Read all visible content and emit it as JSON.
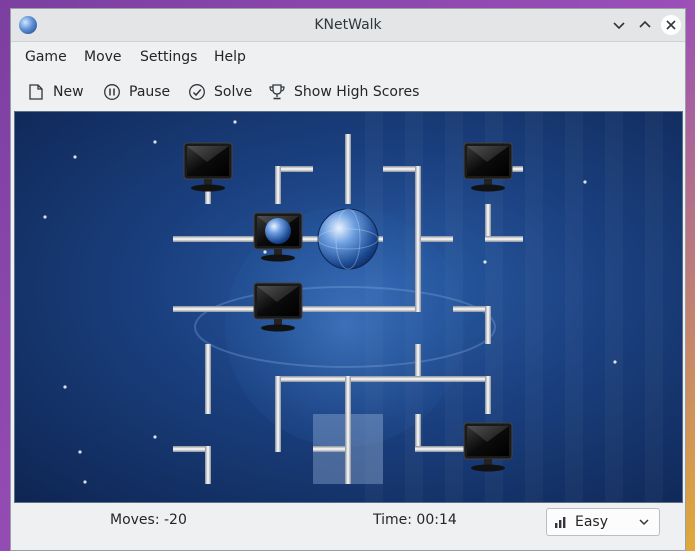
{
  "window": {
    "title": "KNetWalk"
  },
  "menu": [
    "Game",
    "Move",
    "Settings",
    "Help"
  ],
  "toolbar": {
    "new_label": "New",
    "pause_label": "Pause",
    "solve_label": "Solve",
    "highscores_label": "Show High Scores"
  },
  "status": {
    "moves": "Moves: -20",
    "time": "Time: 00:14",
    "difficulty": "Easy"
  },
  "icons": {
    "app": "globe-icon",
    "new": "new-document-icon",
    "pause": "pause-icon",
    "solve": "checkmark-icon",
    "highscores": "trophy-icon",
    "difficulty": "signal-bars-icon"
  },
  "board": {
    "columns": 5,
    "rows": 5,
    "selected_cell": [
      2,
      4
    ],
    "tiles": [
      {
        "col": 0,
        "row": 0,
        "kind": "computer",
        "links": [
          "down"
        ]
      },
      {
        "col": 1,
        "row": 0,
        "kind": "pipe",
        "links": [
          "right",
          "down"
        ]
      },
      {
        "col": 2,
        "row": 0,
        "kind": "pipe",
        "links": [
          "up",
          "down"
        ]
      },
      {
        "col": 3,
        "row": 0,
        "kind": "pipe",
        "links": [
          "left",
          "down"
        ]
      },
      {
        "col": 4,
        "row": 0,
        "kind": "computer",
        "links": [
          "right"
        ]
      },
      {
        "col": 0,
        "row": 1,
        "kind": "pipe",
        "links": [
          "left",
          "right"
        ]
      },
      {
        "col": 1,
        "row": 1,
        "kind": "computer",
        "links": [
          "left",
          "right"
        ]
      },
      {
        "col": 2,
        "row": 1,
        "kind": "server",
        "links": [
          "left",
          "right"
        ]
      },
      {
        "col": 3,
        "row": 1,
        "kind": "pipe",
        "links": [
          "up",
          "right",
          "down"
        ]
      },
      {
        "col": 4,
        "row": 1,
        "kind": "pipe",
        "links": [
          "up",
          "right"
        ]
      },
      {
        "col": 0,
        "row": 2,
        "kind": "pipe",
        "links": [
          "left",
          "right"
        ]
      },
      {
        "col": 1,
        "row": 2,
        "kind": "computer",
        "links": [
          "left",
          "right"
        ]
      },
      {
        "col": 2,
        "row": 2,
        "kind": "pipe",
        "links": [
          "left",
          "right"
        ]
      },
      {
        "col": 3,
        "row": 2,
        "kind": "pipe",
        "links": [
          "left",
          "up"
        ]
      },
      {
        "col": 4,
        "row": 2,
        "kind": "pipe",
        "links": [
          "left",
          "down"
        ]
      },
      {
        "col": 0,
        "row": 3,
        "kind": "pipe",
        "links": [
          "up",
          "down"
        ]
      },
      {
        "col": 1,
        "row": 3,
        "kind": "pipe",
        "links": [
          "right",
          "down"
        ]
      },
      {
        "col": 2,
        "row": 3,
        "kind": "pipe",
        "links": [
          "left",
          "right",
          "down"
        ]
      },
      {
        "col": 3,
        "row": 3,
        "kind": "pipe",
        "links": [
          "left",
          "up",
          "right"
        ]
      },
      {
        "col": 4,
        "row": 3,
        "kind": "pipe",
        "links": [
          "left",
          "down"
        ]
      },
      {
        "col": 0,
        "row": 4,
        "kind": "pipe",
        "links": [
          "left",
          "down"
        ]
      },
      {
        "col": 1,
        "row": 4,
        "kind": "pipe",
        "links": [
          "up"
        ]
      },
      {
        "col": 2,
        "row": 4,
        "kind": "pipe",
        "links": [
          "left",
          "up",
          "down"
        ]
      },
      {
        "col": 3,
        "row": 4,
        "kind": "pipe",
        "links": [
          "up",
          "right"
        ]
      },
      {
        "col": 4,
        "row": 4,
        "kind": "computer",
        "links": [
          "left"
        ]
      }
    ]
  }
}
